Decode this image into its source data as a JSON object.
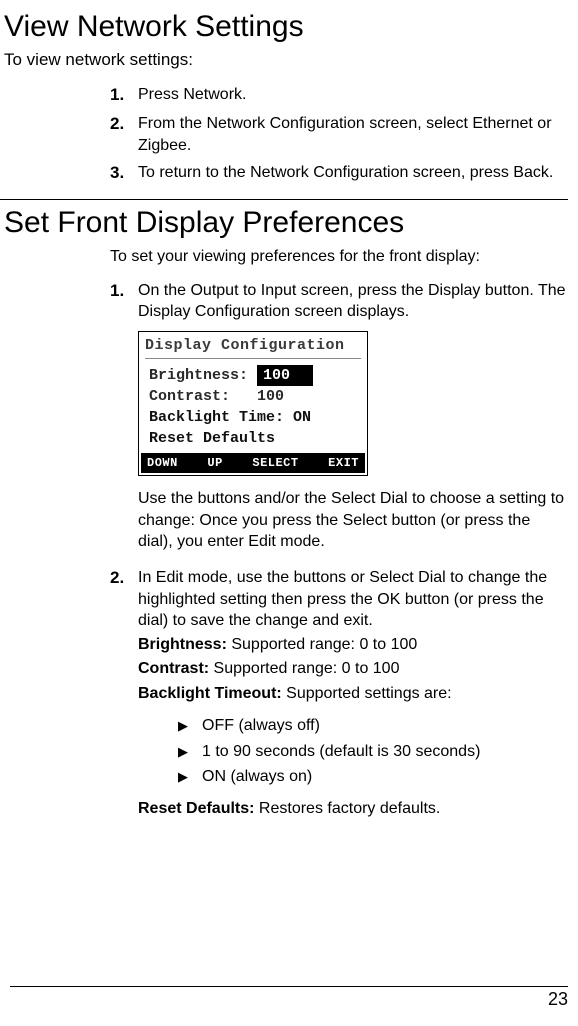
{
  "section1": {
    "heading": "View Network Settings",
    "intro": "To view network settings:",
    "steps": [
      {
        "num": "1.",
        "text": "Press Network."
      },
      {
        "num": "2.",
        "text": "From the Network Configuration screen, select Ethernet or Zigbee."
      },
      {
        "num": "3.",
        "text": "To return to the Network Configuration screen, press Back."
      }
    ]
  },
  "section2": {
    "heading": "Set Front Display Preferences",
    "preamble": "To set your viewing preferences for the front display:",
    "step1": {
      "num": "1.",
      "text_a": "On the Output to Input screen, press the ",
      "text_btn": "Display",
      "text_b": " button. The Display Configuration screen displays."
    },
    "lcd": {
      "title": "Display Configuration",
      "rows": {
        "brightness_label": "Brightness:",
        "brightness_value": "100",
        "contrast_label": "Contrast:",
        "contrast_value": "100",
        "backlight_label": "Backlight Time:",
        "backlight_value": "ON",
        "reset": "Reset Defaults"
      },
      "footer": {
        "a": "DOWN",
        "b": "UP",
        "c": "SELECT",
        "d": "EXIT"
      }
    },
    "step1_post": "Use the buttons and/or the Select Dial to choose a setting to change: Once you press the Select button (or press the dial), you enter Edit mode.",
    "step2": {
      "num": "2.",
      "text_a": "In Edit mode, use the buttons or Select Dial to change the highlighted setting then press the ",
      "text_btn": "OK",
      "text_b": " button (or press the dial) to save the change and exit."
    },
    "settings": {
      "brightness_label": "Brightness:",
      "brightness_text": " Supported range: 0 to 100",
      "contrast_label": "Contrast:",
      "contrast_text": " Supported range: 0 to 100",
      "backlight_label": "Backlight Timeout:",
      "backlight_text": " Supported settings are:"
    },
    "bullets": [
      "OFF (always off)",
      "1 to 90 seconds (default is 30 seconds)",
      "ON (always on)"
    ],
    "reset_label": "Reset Defaults:",
    "reset_text": " Restores factory defaults."
  },
  "page_number": "23"
}
